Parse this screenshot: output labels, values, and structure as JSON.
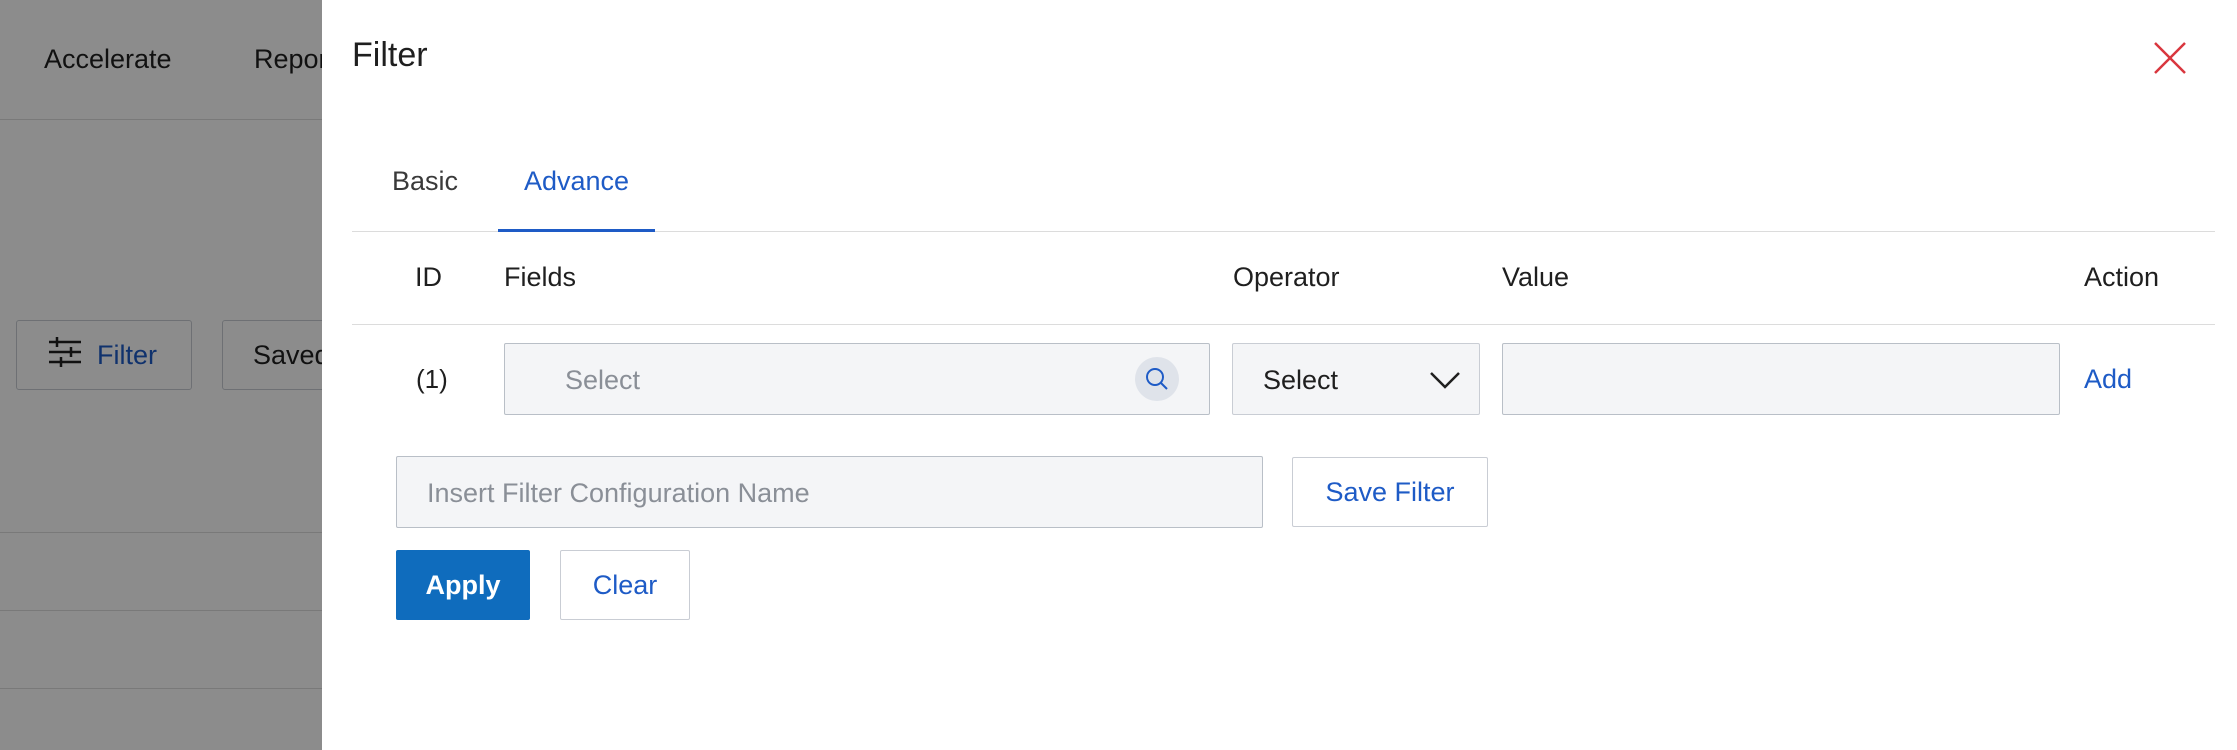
{
  "background": {
    "nav": [
      "Accelerate",
      "Repor"
    ],
    "filter_button_label": "Filter",
    "saved_button_label": "Saved"
  },
  "drawer": {
    "title": "Filter",
    "close_icon": "close-icon",
    "tabs": [
      {
        "label": "Basic",
        "active": false
      },
      {
        "label": "Advance",
        "active": true
      }
    ],
    "table": {
      "headers": {
        "id": "ID",
        "fields": "Fields",
        "operator": "Operator",
        "value": "Value",
        "action": "Action"
      },
      "rows": [
        {
          "id": "(1)",
          "fields_placeholder": "Select",
          "operator_value": "Select",
          "value": "",
          "action": "Add"
        }
      ]
    },
    "config_name_placeholder": "Insert Filter Configuration Name",
    "save_filter_label": "Save Filter",
    "apply_label": "Apply",
    "clear_label": "Clear"
  },
  "colors": {
    "accent": "#1e5bc6",
    "primary_button": "#0f6cbd",
    "close_icon": "#d9363e",
    "overlay": "rgba(0,0,0,0.45)"
  }
}
